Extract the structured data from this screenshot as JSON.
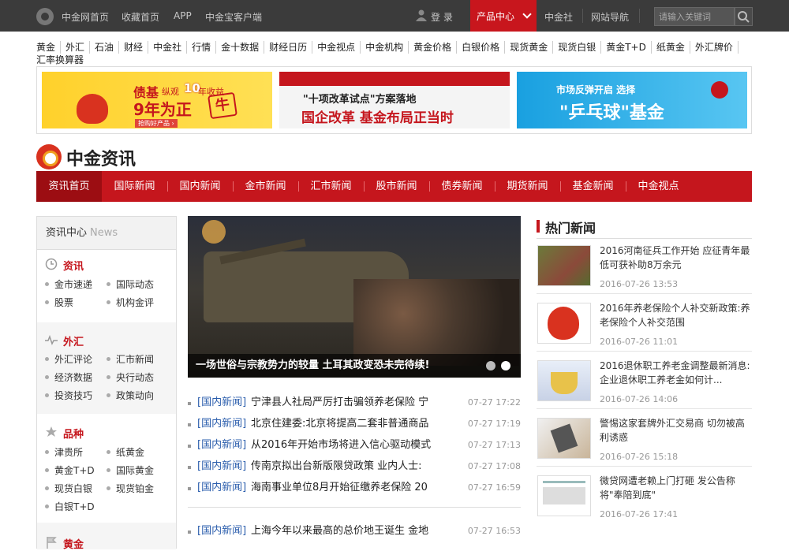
{
  "topbar": {
    "links": [
      "中金网首页",
      "收藏首页",
      "APP",
      "中金宝客户端"
    ],
    "login": "登 录",
    "product_center": "产品中心",
    "right_links": [
      "中金社",
      "网站导航"
    ],
    "search_placeholder": "请输入关键词"
  },
  "quicknav": [
    "黄金",
    "外汇",
    "石油",
    "财经",
    "中金社",
    "行情",
    "金十数据",
    "财经日历",
    "中金视点",
    "中金机构",
    "黄金价格",
    "白银价格",
    "现货黄金",
    "现货白银",
    "黄金T+D",
    "纸黄金",
    "外汇牌价",
    "汇率换算器"
  ],
  "ads": {
    "ad1": {
      "line1": "债基",
      "line2": "纵观",
      "line3": "10",
      "line4": "年收益",
      "main": "9年为正",
      "stamp": "牛",
      "btn": "抢购好产品 ›"
    },
    "ad2": {
      "top": "\"十项改革试点\"方案落地",
      "main": "国企改革 基金布局正当时"
    },
    "ad3": {
      "top": "市场反弹开启 选择",
      "main": "\"乒乓球\"基金"
    }
  },
  "brand": {
    "name": "中金资讯"
  },
  "mainnav": [
    "资讯首页",
    "国际新闻",
    "国内新闻",
    "金市新闻",
    "汇市新闻",
    "股市新闻",
    "债券新闻",
    "期货新闻",
    "基金新闻",
    "中金视点"
  ],
  "sidebar": {
    "head": "资讯中心",
    "head_en": "News",
    "sections": [
      {
        "title": "资讯",
        "links": [
          "金市速递",
          "国际动态",
          "股票",
          "机构金评"
        ]
      },
      {
        "title": "外汇",
        "links": [
          "外汇评论",
          "汇市新闻",
          "经济数据",
          "央行动态",
          "投资技巧",
          "政策动向"
        ]
      },
      {
        "title": "品种",
        "links": [
          "津贵所",
          "纸黄金",
          "黄金T+D",
          "国际黄金",
          "现货白银",
          "现货铂金",
          "白银T+D"
        ]
      },
      {
        "title": "黄金",
        "links": []
      }
    ]
  },
  "hero": {
    "caption": "一场世俗与宗教势力的较量 土耳其政变恐未完待续!"
  },
  "news": [
    {
      "cat": "[国内新闻]",
      "title": "宁津县人社局严厉打击骗领养老保险 宁",
      "time": "07-27 17:22"
    },
    {
      "cat": "[国内新闻]",
      "title": "北京住建委:北京将提高二套非普通商品",
      "time": "07-27 17:19"
    },
    {
      "cat": "[国内新闻]",
      "title": "从2016年开始市场将进入信心驱动模式",
      "time": "07-27 17:13"
    },
    {
      "cat": "[国内新闻]",
      "title": "传南京拟出台新版限贷政策 业内人士:",
      "time": "07-27 17:08"
    },
    {
      "cat": "[国内新闻]",
      "title": "海南事业单位8月开始征缴养老保险 20",
      "time": "07-27 16:59"
    },
    {
      "cat": "[国内新闻]",
      "title": "上海今年以来最高的总价地王诞生 金地",
      "time": "07-27 16:53"
    }
  ],
  "hot": {
    "title": "热门新闻",
    "items": [
      {
        "title": "2016河南征兵工作开始 应征青年最低可获补助8万余元",
        "date": "2016-07-26 13:53"
      },
      {
        "title": "2016年养老保险个人补交新政策:养老保险个人补交范围",
        "date": "2016-07-26 11:01"
      },
      {
        "title": "2016退休职工养老金调整最新消息:企业退休职工养老金如何计...",
        "date": "2016-07-26 14:06"
      },
      {
        "title": "警惕这家套牌外汇交易商 切勿被高利诱惑",
        "date": "2016-07-26 15:18"
      },
      {
        "title": "微贷网遭老赖上门打砸 发公告称将\"奉陪到底\"",
        "date": "2016-07-26 17:41"
      }
    ]
  },
  "colors": {
    "brand_red": "#c5161d",
    "topbar": "#3b3b3b",
    "link_blue": "#2a5dac"
  }
}
